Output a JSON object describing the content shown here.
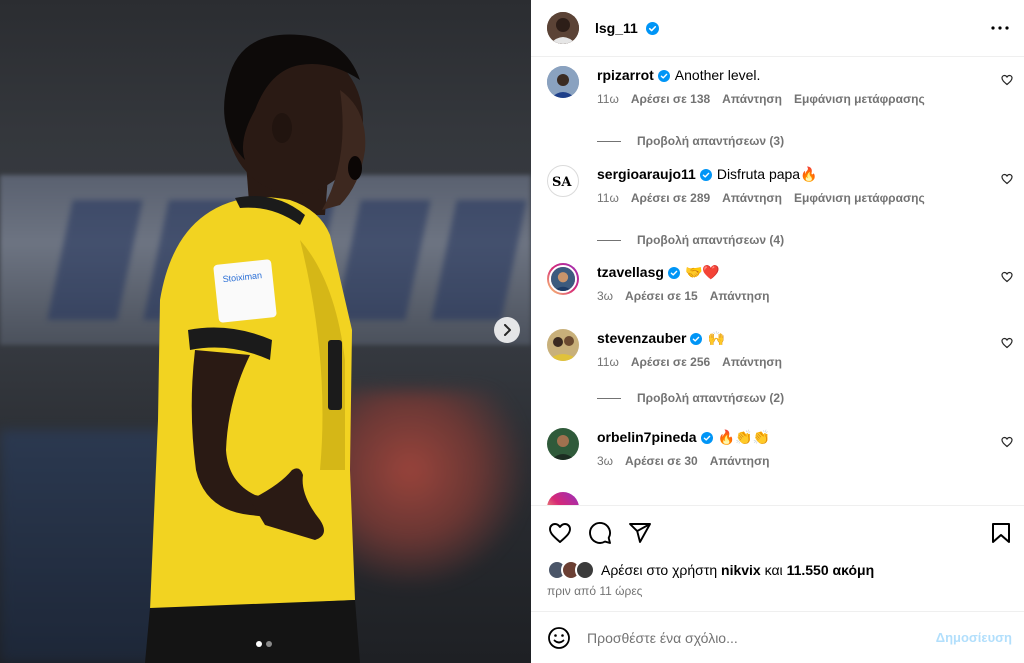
{
  "post": {
    "username": "lsg_11",
    "more_icon": "more-horizontal-icon"
  },
  "media": {
    "next_icon": "chevron-right-icon",
    "slide_count": 2,
    "active_slide": 1,
    "jersey_sponsor": "Stoiximan"
  },
  "comments": [
    {
      "user": "rpizarrot",
      "verified": true,
      "text": "Another level.",
      "time": "11ω",
      "likes": "Αρέσει σε 138",
      "reply": "Απάντηση",
      "translate": "Εμφάνιση μετάφρασης",
      "replies": "Προβολή απαντήσεων (3)"
    },
    {
      "user": "sergioaraujo11",
      "verified": true,
      "text": "Disfruta papa🔥",
      "time": "11ω",
      "likes": "Αρέσει σε 289",
      "reply": "Απάντηση",
      "translate": "Εμφάνιση μετάφρασης",
      "replies": "Προβολή απαντήσεων (4)"
    },
    {
      "user": "tzavellasg",
      "verified": true,
      "text": "🤝❤️",
      "time": "3ω",
      "likes": "Αρέσει σε 15",
      "reply": "Απάντηση"
    },
    {
      "user": "stevenzauber",
      "verified": true,
      "text": "🙌",
      "time": "11ω",
      "likes": "Αρέσει σε 256",
      "reply": "Απάντηση",
      "replies": "Προβολή απαντήσεων (2)"
    },
    {
      "user": "orbelin7pineda",
      "verified": true,
      "text": "🔥👏👏",
      "time": "3ω",
      "likes": "Αρέσει σε 30",
      "reply": "Απάντηση"
    }
  ],
  "actions": {
    "like_icon": "heart-icon",
    "comment_icon": "comment-icon",
    "share_icon": "send-icon",
    "save_icon": "bookmark-icon"
  },
  "likes_summary": {
    "prefix": "Αρέσει στο χρήστη",
    "user": "nikvix",
    "conj": "και",
    "others": "11.550 ακόμη"
  },
  "time_ago": "πριν από 11 ώρες",
  "add_comment": {
    "emoji_icon": "emoji-icon",
    "placeholder": "Προσθέστε ένα σχόλιο...",
    "post_label": "Δημοσίευση"
  },
  "colors": {
    "verified": "#0095f6",
    "meta_gray": "#737373",
    "jersey_yellow": "#f2d321",
    "post_btn_disabled": "#b2dffc"
  }
}
